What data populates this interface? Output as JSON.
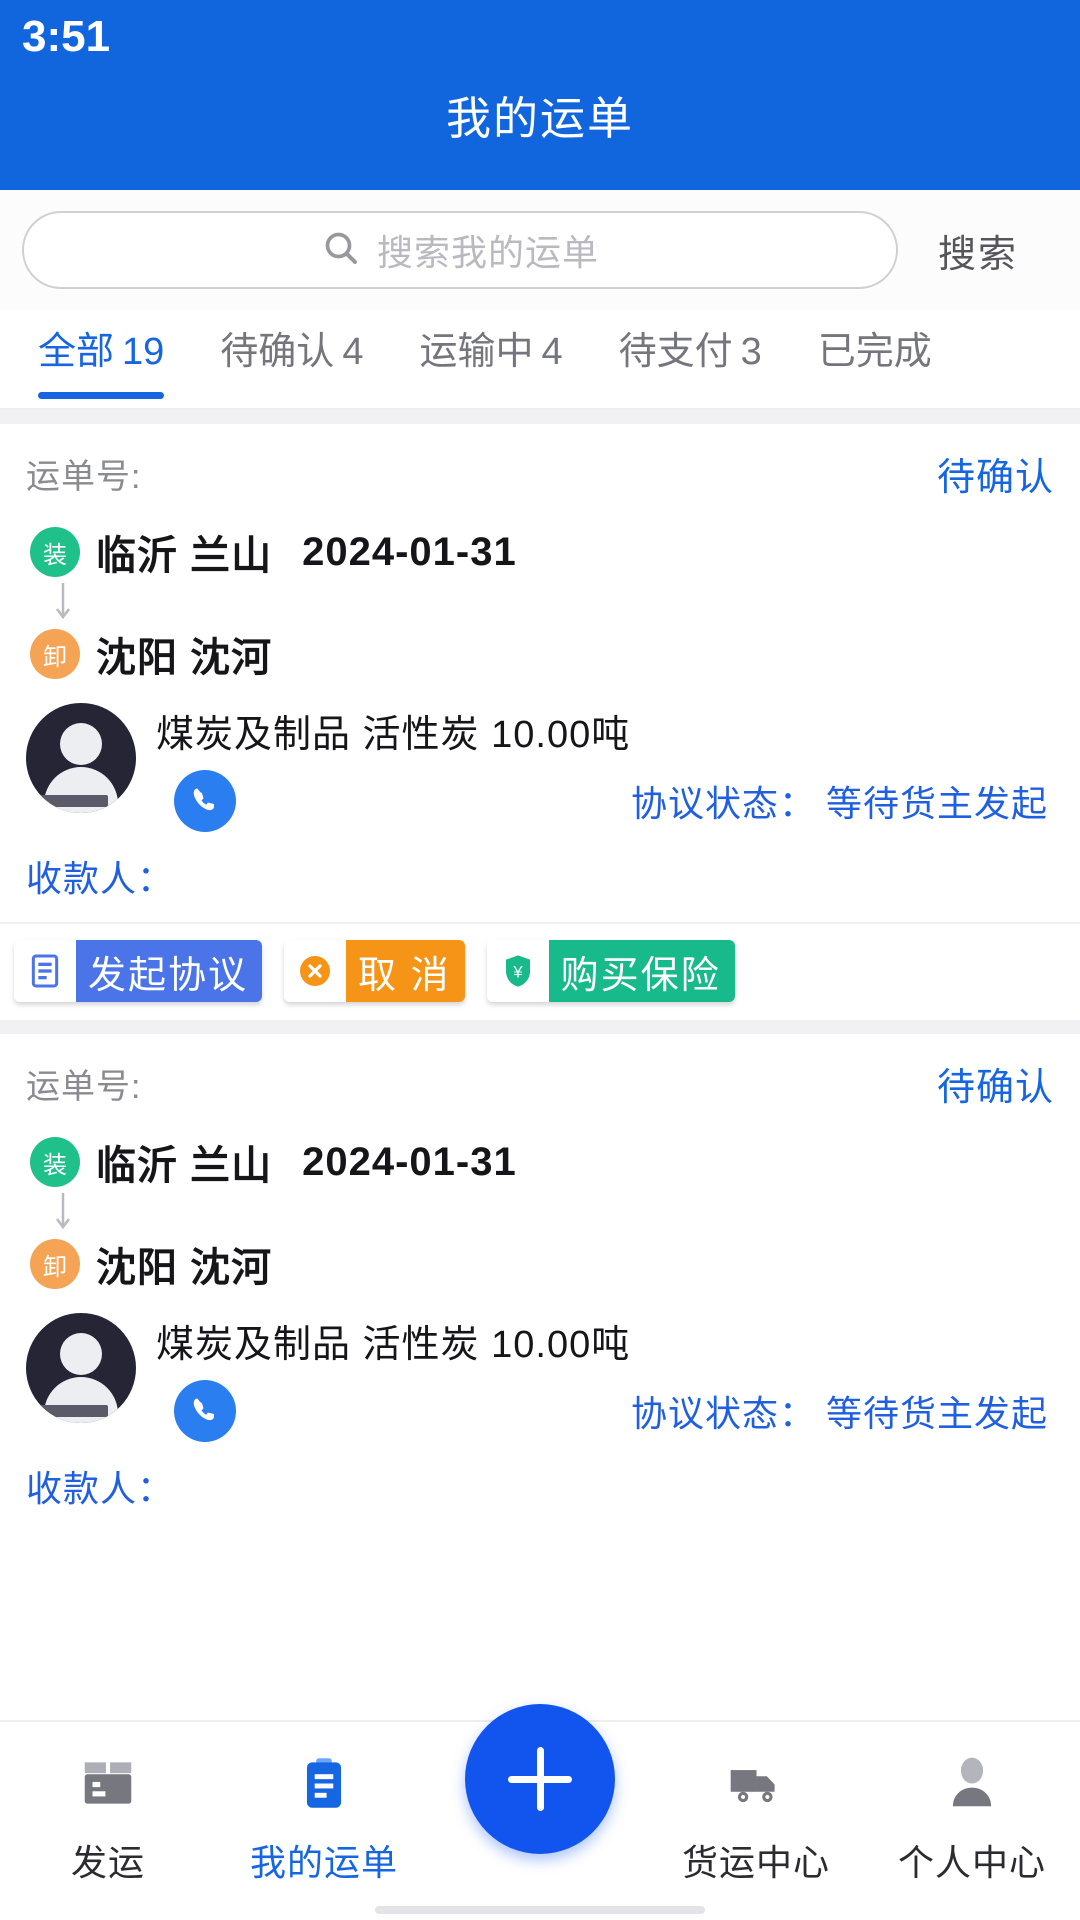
{
  "status_bar": {
    "time": "3:51"
  },
  "header": {
    "title": "我的运单"
  },
  "search": {
    "placeholder": "搜索我的运单",
    "value": "",
    "button_label": "搜索",
    "icon": "search-icon"
  },
  "tabs": [
    {
      "label": "全部",
      "count": "19",
      "active": true
    },
    {
      "label": "待确认",
      "count": "4",
      "active": false
    },
    {
      "label": "运输中",
      "count": "4",
      "active": false
    },
    {
      "label": "待支付",
      "count": "3",
      "active": false
    },
    {
      "label": "已完成",
      "count": "",
      "active": false
    }
  ],
  "colors": {
    "primary": "#1266dd",
    "accent": "#1566e0",
    "load_badge": "#20c08a",
    "unload_badge": "#f5a355",
    "action_blue": "#4a74e8",
    "action_orange": "#f59416",
    "action_green": "#18b98a"
  },
  "cards": [
    {
      "order_label": "运单号:",
      "order_number": "",
      "status": "待确认",
      "load_badge": "装",
      "load_place": "临沂 兰山",
      "load_date": "2024-01-31",
      "unload_badge": "卸",
      "unload_place": "沈阳 沈河",
      "cargo": "煤炭及制品  活性炭 10.00吨",
      "agreement_label": "协议状态：",
      "agreement_value": "等待货主发起",
      "payee_label": "收款人：",
      "payee_value": "",
      "phone_icon": "phone-icon",
      "avatar_icon": "avatar-icon",
      "actions": [
        {
          "label": "发起协议",
          "style": "blue",
          "icon": "document-icon"
        },
        {
          "label": "取 消",
          "style": "orange",
          "icon": "close-circle-icon"
        },
        {
          "label": "购买保险",
          "style": "green",
          "icon": "shield-yuan-icon"
        }
      ]
    },
    {
      "order_label": "运单号:",
      "order_number": "",
      "status": "待确认",
      "load_badge": "装",
      "load_place": "临沂 兰山",
      "load_date": "2024-01-31",
      "unload_badge": "卸",
      "unload_place": "沈阳 沈河",
      "cargo": "煤炭及制品  活性炭 10.00吨",
      "agreement_label": "协议状态：",
      "agreement_value": "等待货主发起",
      "payee_label": "收款人：",
      "payee_value": "",
      "phone_icon": "phone-icon",
      "avatar_icon": "avatar-icon",
      "actions": []
    }
  ],
  "bottom_nav": {
    "items": [
      {
        "label": "发运",
        "icon": "box-icon",
        "active": false
      },
      {
        "label": "我的运单",
        "icon": "clipboard-icon",
        "active": true
      },
      {
        "label": "货运中心",
        "icon": "truck-icon",
        "active": false
      },
      {
        "label": "个人中心",
        "icon": "person-icon",
        "active": false
      }
    ],
    "fab": {
      "icon": "plus-icon",
      "label": ""
    }
  }
}
